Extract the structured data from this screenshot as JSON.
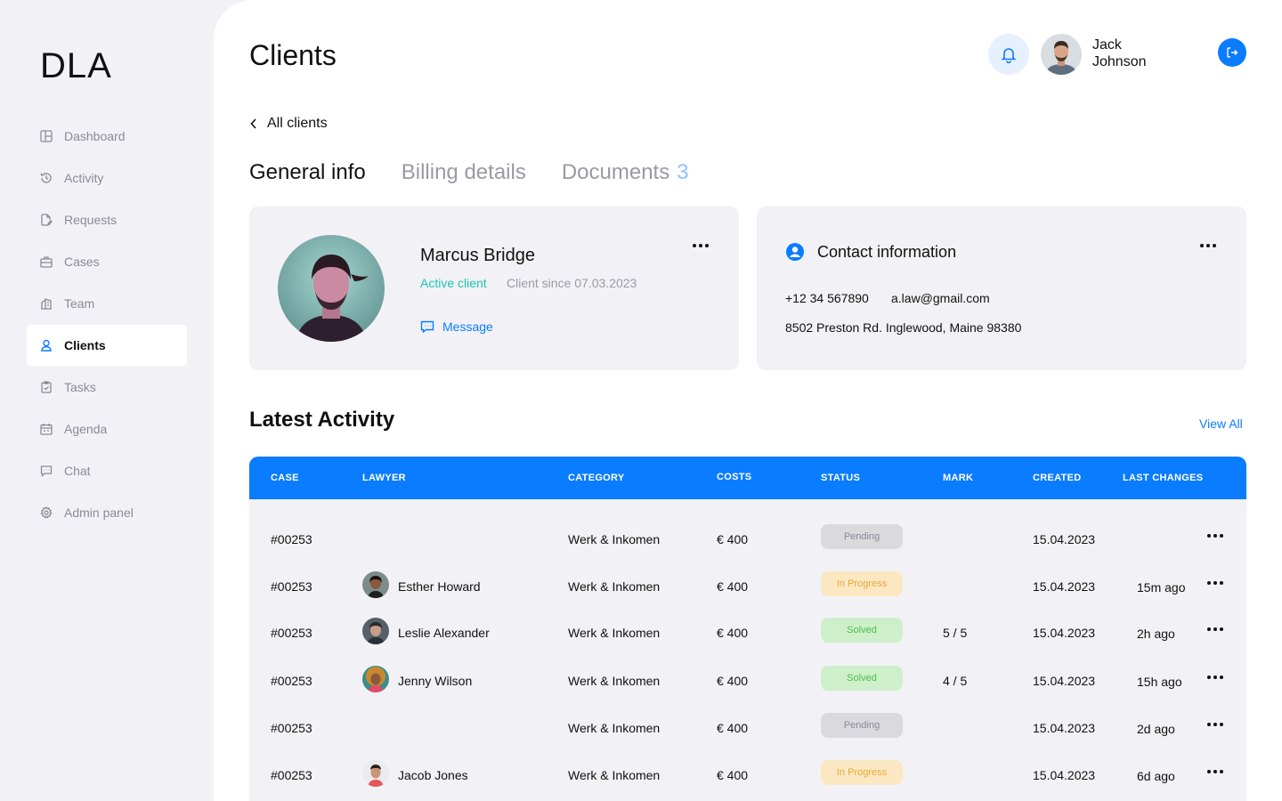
{
  "app": {
    "logo": "DLA"
  },
  "sidebar": {
    "items": [
      {
        "label": "Dashboard",
        "icon": "dashboard-icon"
      },
      {
        "label": "Activity",
        "icon": "history-icon"
      },
      {
        "label": "Requests",
        "icon": "document-edit-icon"
      },
      {
        "label": "Cases",
        "icon": "briefcase-icon"
      },
      {
        "label": "Team",
        "icon": "building-icon"
      },
      {
        "label": "Clients",
        "icon": "user-icon",
        "active": true
      },
      {
        "label": "Tasks",
        "icon": "clipboard-check-icon"
      },
      {
        "label": "Agenda",
        "icon": "calendar-icon"
      },
      {
        "label": "Chat",
        "icon": "chat-icon"
      },
      {
        "label": "Admin panel",
        "icon": "gear-icon"
      }
    ]
  },
  "header": {
    "title": "Clients",
    "user": {
      "first": "Jack",
      "last": "Johnson"
    }
  },
  "back": {
    "label": "All clients"
  },
  "tabs": {
    "general": "General info",
    "billing": "Billing details",
    "documents": "Documents",
    "documents_count": "3"
  },
  "profile": {
    "name": "Marcus Bridge",
    "status": "Active client",
    "since": "Client since 07.03.2023",
    "message_label": "Message"
  },
  "contact": {
    "title": "Contact information",
    "phone": "+12 34 567890",
    "email": "a.law@gmail.com",
    "address": "8502 Preston Rd. Inglewood, Maine 98380"
  },
  "activity": {
    "title": "Latest Activity",
    "view_all": "View All",
    "columns": [
      "CASE",
      "LAWYER",
      "CATEGORY",
      "COSTS",
      "STATUS",
      "MARK",
      "CREATED",
      "LAST CHANGES"
    ],
    "rows": [
      {
        "case": "#00253",
        "lawyer": "",
        "category": "Werk & Inkomen",
        "costs": "€ 400",
        "status": "Pending",
        "mark": "",
        "created": "15.04.2023",
        "last": ""
      },
      {
        "case": "#00253",
        "lawyer": "Esther Howard",
        "category": "Werk & Inkomen",
        "costs": "€ 400",
        "status": "In Progress",
        "mark": "",
        "created": "15.04.2023",
        "last": "15m ago"
      },
      {
        "case": "#00253",
        "lawyer": "Leslie Alexander",
        "category": "Werk & Inkomen",
        "costs": "€ 400",
        "status": "Solved",
        "mark": "5 / 5",
        "created": "15.04.2023",
        "last": "2h ago"
      },
      {
        "case": "#00253",
        "lawyer": "Jenny Wilson",
        "category": "Werk & Inkomen",
        "costs": "€ 400",
        "status": "Solved",
        "mark": "4 / 5",
        "created": "15.04.2023",
        "last": "15h ago"
      },
      {
        "case": "#00253",
        "lawyer": "",
        "category": "Werk & Inkomen",
        "costs": "€ 400",
        "status": "Pending",
        "mark": "",
        "created": "15.04.2023",
        "last": "2d ago"
      },
      {
        "case": "#00253",
        "lawyer": "Jacob Jones",
        "category": "Werk & Inkomen",
        "costs": "€ 400",
        "status": "In Progress",
        "mark": "",
        "created": "15.04.2023",
        "last": "6d ago"
      }
    ]
  },
  "colors": {
    "accent": "#0A7CFF",
    "active_client": "#1CC6B4",
    "pending_bg": "#D9D9DE",
    "progress_bg": "#FBE8C2",
    "solved_bg": "#CDEFC9"
  }
}
